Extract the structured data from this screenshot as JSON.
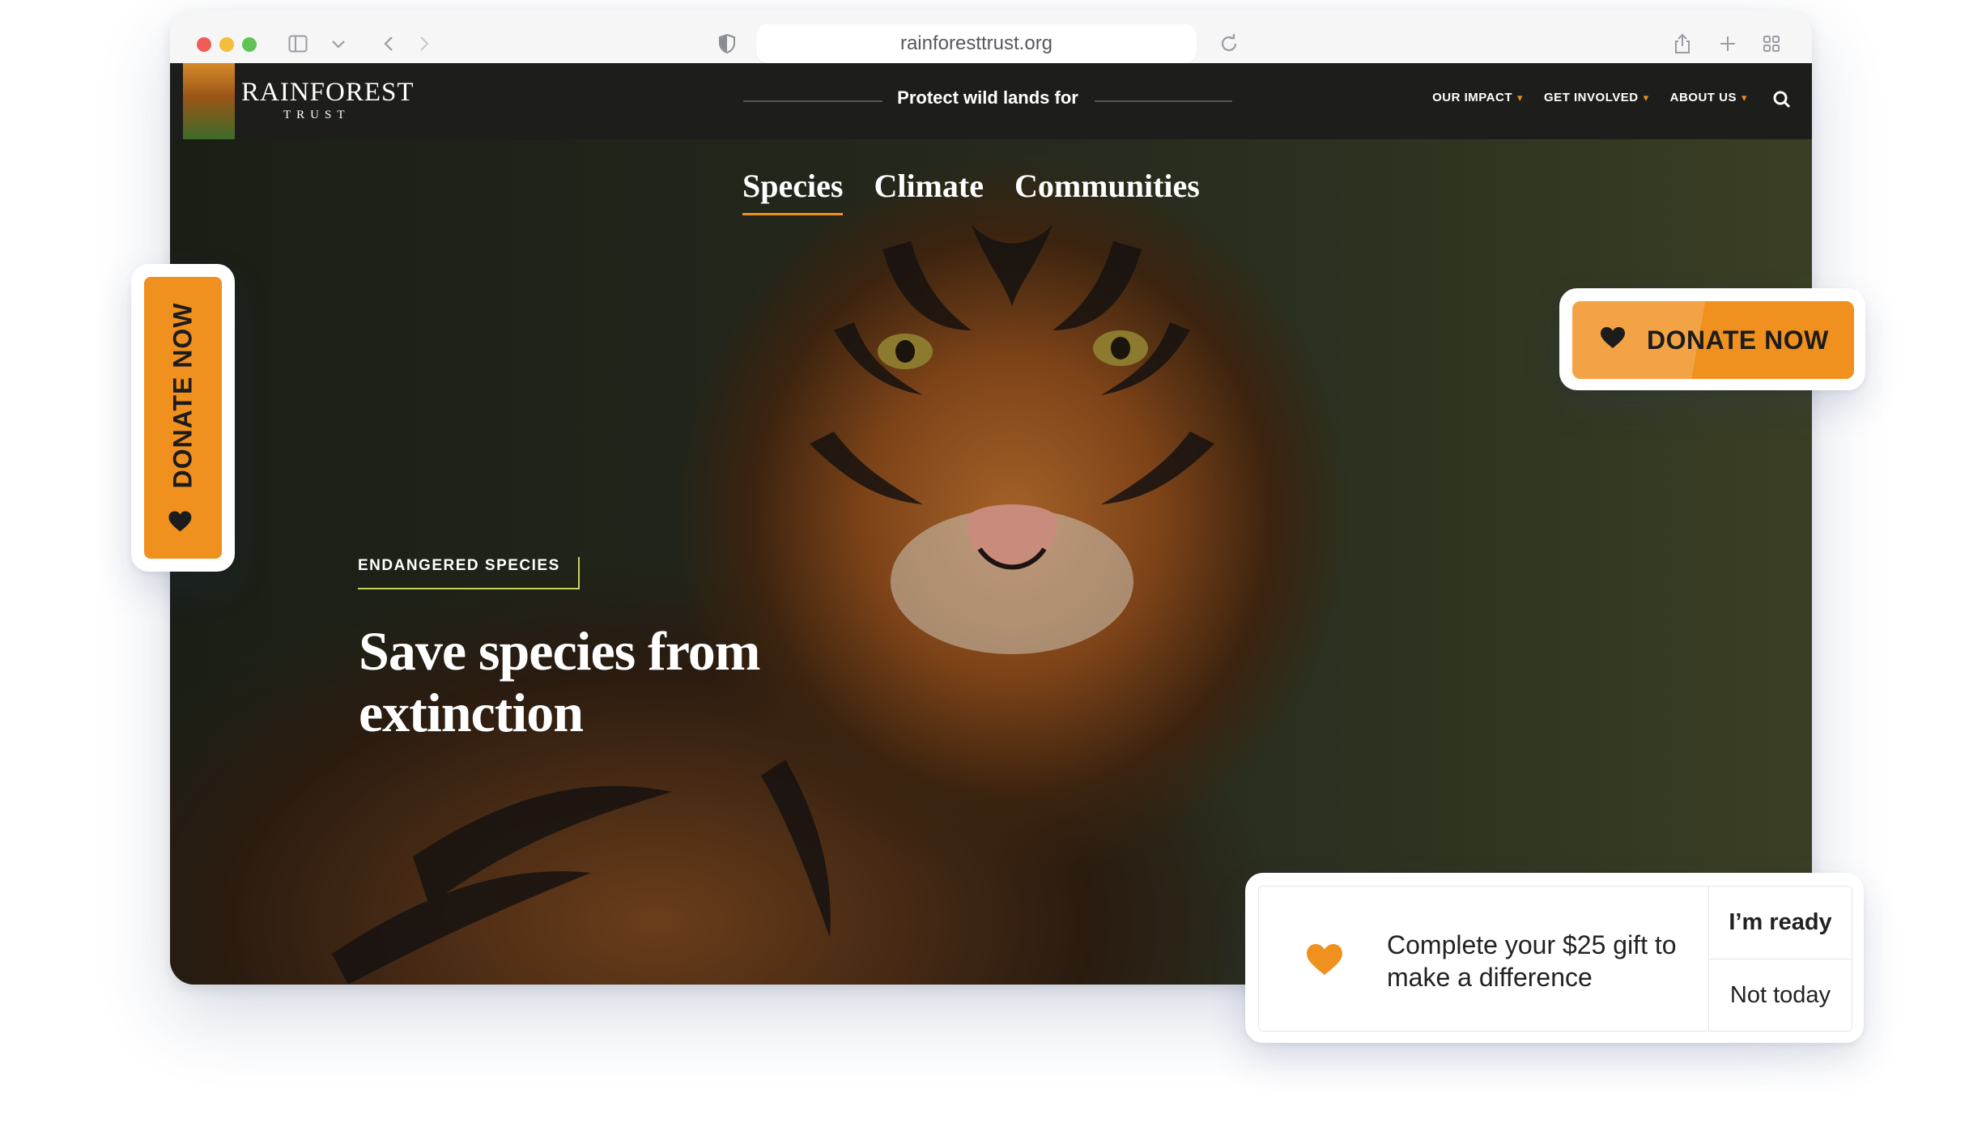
{
  "browser": {
    "url": "rainforesttrust.org"
  },
  "site": {
    "logo_title": "RAINFOREST",
    "logo_sub": "TRUST",
    "nav_tagline": "Protect wild lands for",
    "nav_links": [
      "OUR IMPACT",
      "GET INVOLVED",
      "ABOUT US"
    ],
    "tabs": [
      "Species",
      "Climate",
      "Communities"
    ],
    "active_tab": "Species",
    "badge": "ENDANGERED SPECIES",
    "headline": "Save species from extinction"
  },
  "widgets": {
    "side_donate_label": "DONATE NOW",
    "donate_label": "DONATE NOW",
    "gift_message": "Complete your $25 gift to make a difference",
    "gift_primary": "I’m ready",
    "gift_secondary": "Not today"
  },
  "colors": {
    "accent": "#f0901e",
    "nav_bg": "#1d1d1b",
    "badge_line": "#c7d35a"
  },
  "icons": [
    "heart-icon",
    "search-icon",
    "shield-icon",
    "reload-icon",
    "share-icon",
    "plus-icon",
    "tabs-grid-icon",
    "sidebar-icon",
    "back-icon",
    "forward-icon"
  ]
}
